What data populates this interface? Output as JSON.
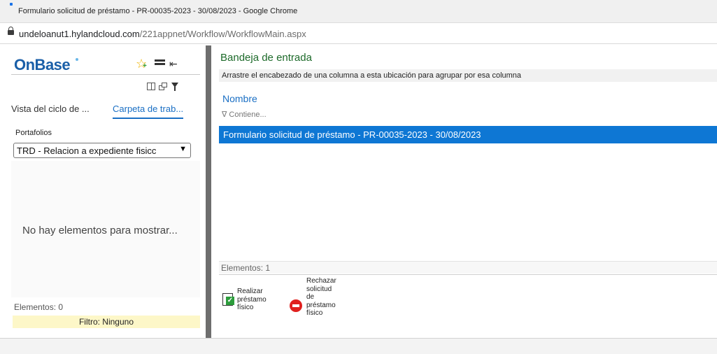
{
  "window": {
    "title": "Formulario solicitud de préstamo - PR-00035-2023 - 30/08/2023 - Google Chrome"
  },
  "address": {
    "host": "undeloanut1.hylandcloud.com",
    "path": "/221appnet/Workflow/WorkflowMain.aspx"
  },
  "left": {
    "brand": "OnBase",
    "tabs": [
      "Vista del ciclo de ...",
      "Carpeta de trab..."
    ],
    "portfolios_label": "Portafolios",
    "portfolio_selected": "TRD - Relacion a expediente fisicc",
    "empty_message": "No hay elementos para mostrar...",
    "count": "Elementos: 0",
    "filter": "Filtro: Ninguno"
  },
  "right": {
    "title": "Bandeja de entrada",
    "group_hint": "Arrastre el encabezado de una columna a esta ubicación para agrupar por esa columna",
    "column_header": "Nombre",
    "filter_placeholder": "Contiene...",
    "rows": [
      "Formulario solicitud de préstamo - PR-00035-2023 - 30/08/2023"
    ],
    "count": "Elementos: 1",
    "actions": [
      {
        "label": "Realizar préstamo físico",
        "icon": "approve-document-icon"
      },
      {
        "label": "Rechazar solicitud de préstamo físico",
        "icon": "reject-icon"
      }
    ]
  },
  "colors": {
    "selection": "#0e77d4",
    "link_blue": "#1a6fc4",
    "title_green": "#1d6a2a",
    "filter_yellow": "#fdf7c8"
  }
}
